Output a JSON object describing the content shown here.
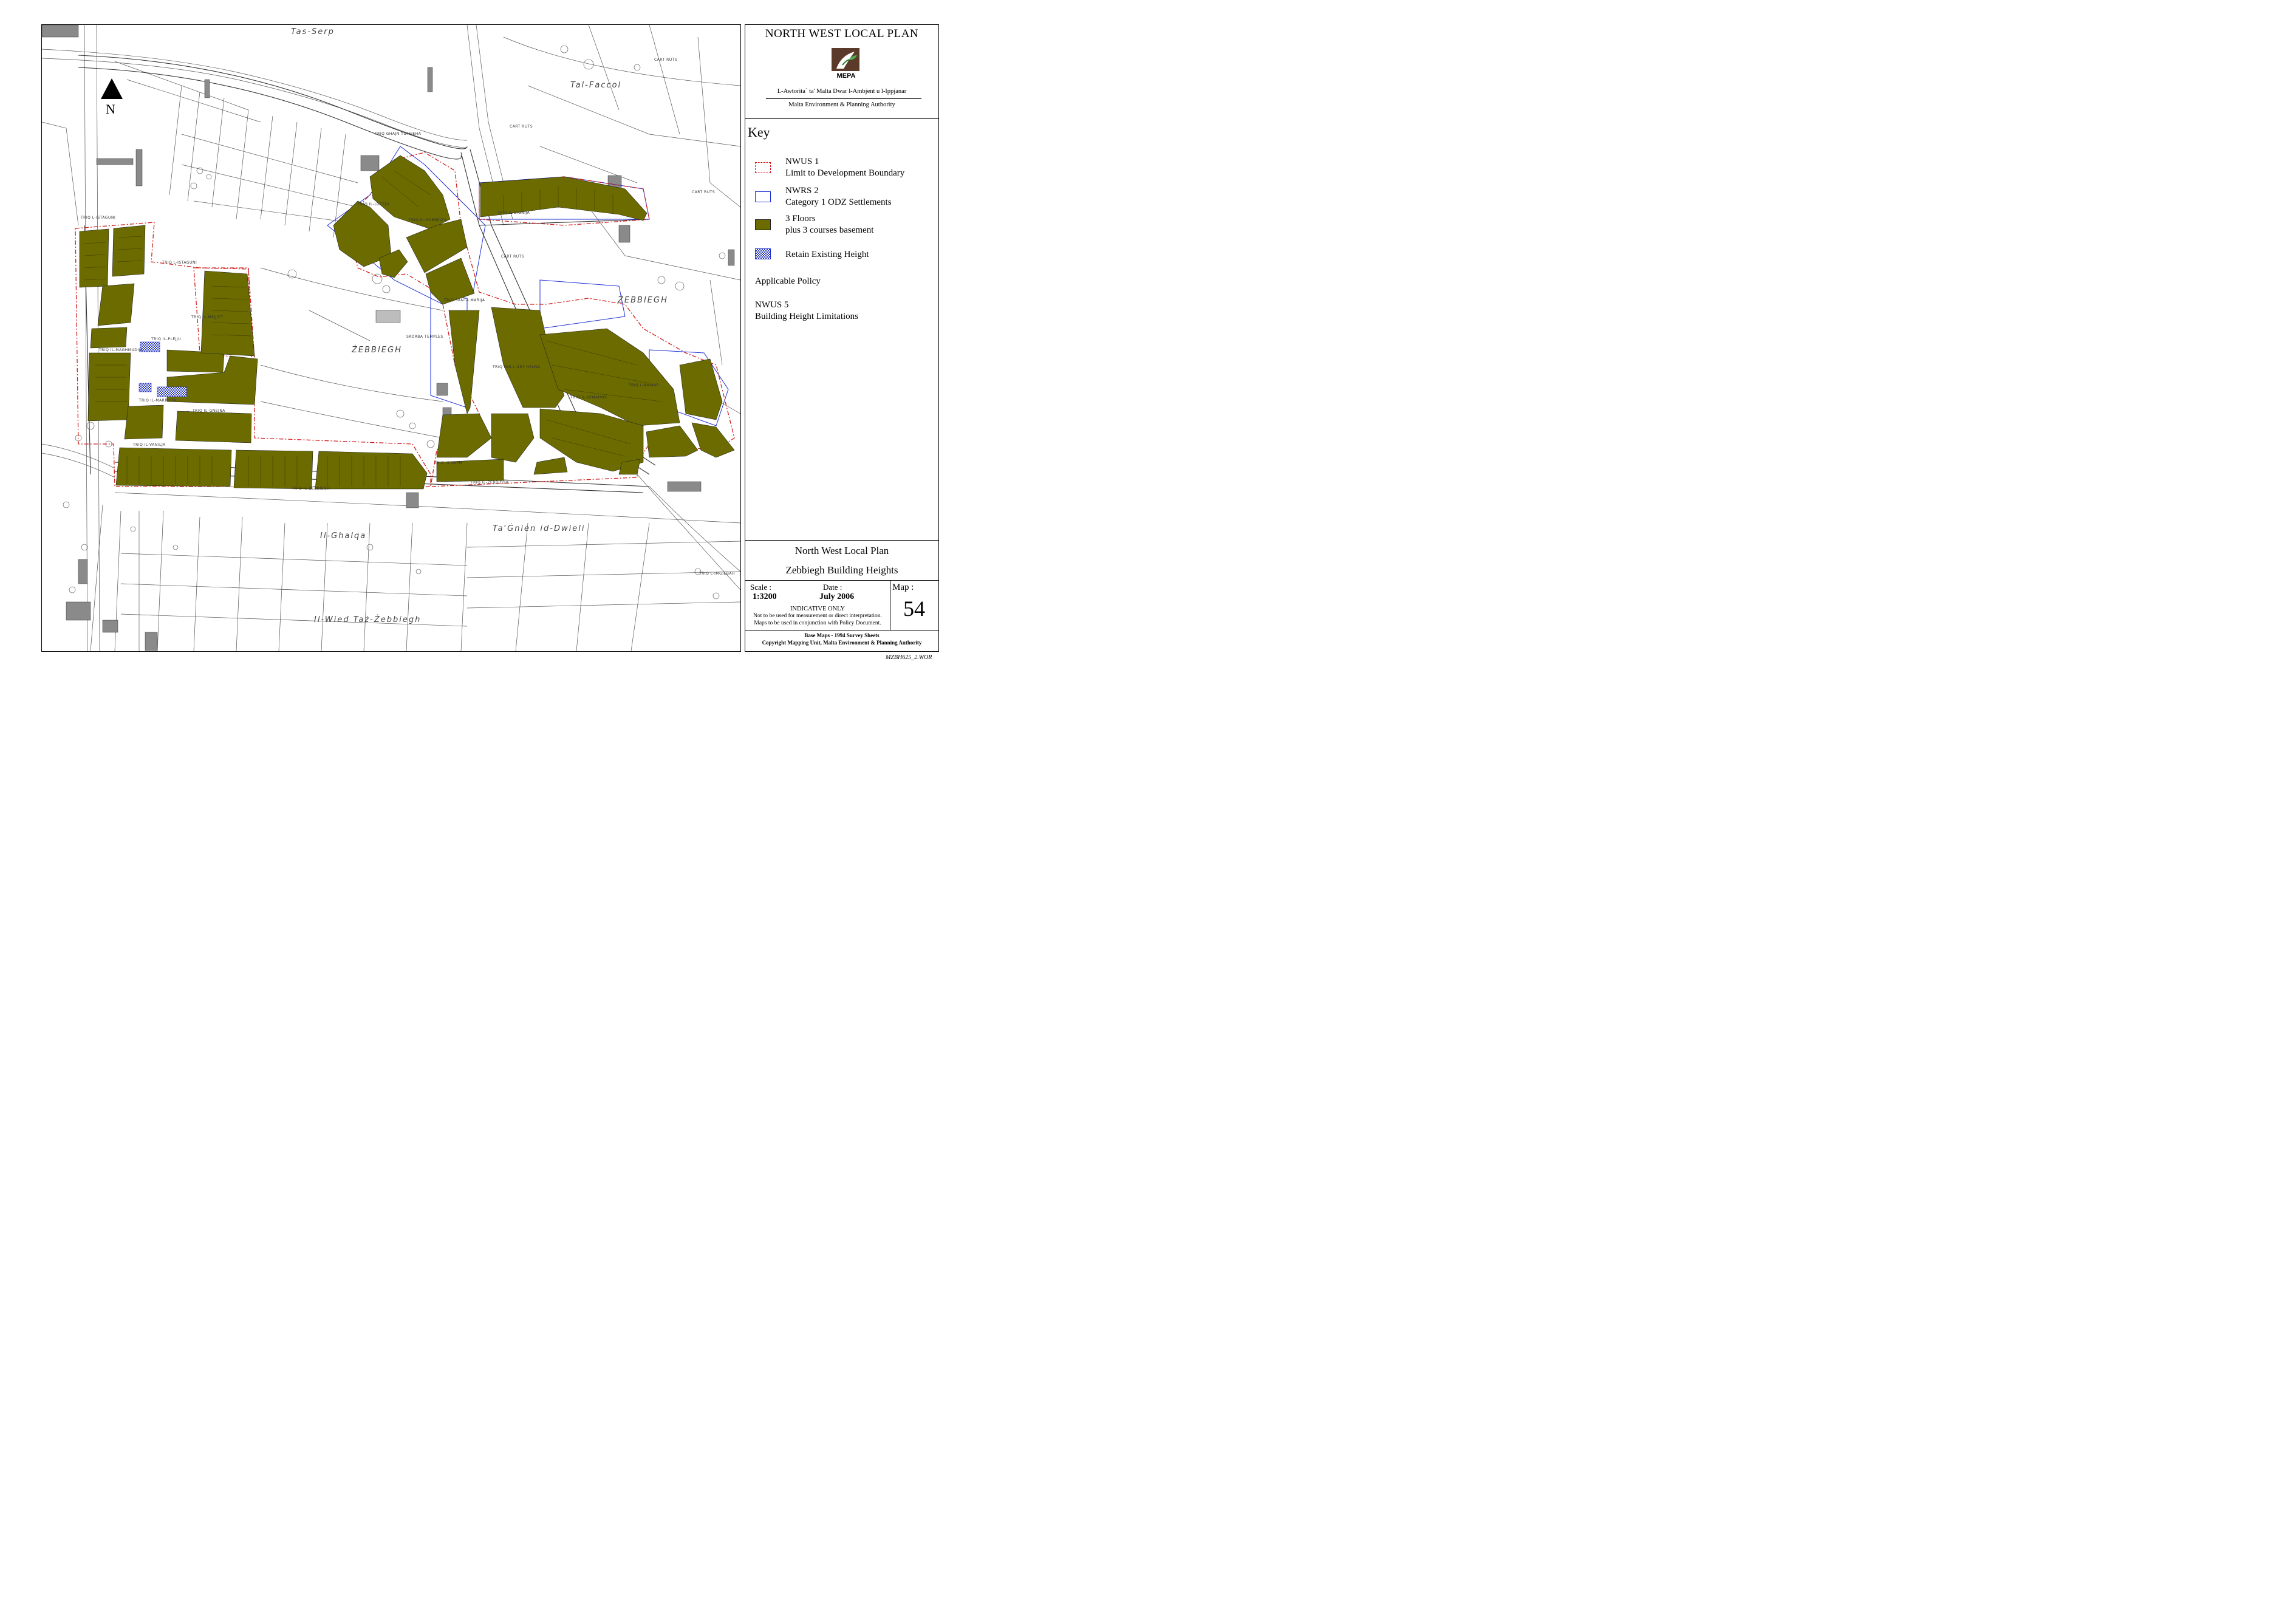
{
  "map": {
    "compass": "N",
    "place_names": [
      "Tas-Serp",
      "Tal-Faccol",
      "ŻEBBIEGH",
      "ŻEBBIEGH",
      "Il-Ghalqa",
      "Ta'Ġnien id-Dwieli",
      "Il-Wied Taż-Żebbiegh"
    ],
    "street_labels": [
      "TRIQ L-ISTAGUNI",
      "TRIQ L-ISTAGUNI",
      "TRIQ IL-PLEJJU",
      "TRIQ IL-MAGHMUDIJA",
      "TRIQ IL-MARRUBA",
      "TRIQ IL-VANILJA",
      "TRIQ IL-ŻEBBIEGH",
      "TRIQ IL-ŻEBBIEGH",
      "TRIQ IL-BIGNIJA",
      "TRIQ IL-HOBBEJZA",
      "TRIQ IL-LUZZJU",
      "TRIQ IS-SEPM",
      "TRIQ IL-GHAMMIX",
      "TRIQ L-AMMAR",
      "TRIQ GHAJN TUFFIEHA",
      "TRIQ DIN L-ART HELWA",
      "TRIQ L-IMGIEBAH",
      "SKORBA TEMPLES",
      "CART RUTS",
      "CART RUTS",
      "CART RUTS",
      "CART RUTS",
      "TRIQ IL-MEJJIET",
      "TRIQ SANTA MARIJA",
      "TRIQ IL-GNEJNA"
    ]
  },
  "panel": {
    "title": "NORTH WEST LOCAL PLAN",
    "logo_text": "MEPA",
    "authority_mt": "L-Awtorita` ta' Malta Dwar l-Ambjent u l-Ippjanar",
    "authority_en": "Malta Environment & Planning Authority",
    "key_heading": "Key",
    "key_items": [
      {
        "line1": "NWUS 1",
        "line2": "Limit to Development Boundary",
        "color": "#d21e1e"
      },
      {
        "line1": "NWRS 2",
        "line2": "Category 1 ODZ Settlements",
        "color": "#1f2fd6"
      },
      {
        "line1": "3 Floors",
        "line2": "plus 3 courses basement",
        "color": "#6b6b00"
      },
      {
        "line1": "Retain Existing Height",
        "line2": "",
        "color": "#2b3bb8"
      }
    ],
    "policy_label": "Applicable Policy",
    "policy_code": "NWUS 5",
    "policy_name": "Building Height Limitations",
    "map_plan": "North West Local Plan",
    "map_title": "Zebbiegh Building Heights",
    "scale_label": "Scale :",
    "scale_value": "1:3200",
    "date_label": "Date :",
    "date_value": "July 2006",
    "map_label": "Map :",
    "map_number": "54",
    "indicative": "INDICATIVE ONLY",
    "note1": "Not to be used for measurement or direct interpretation.",
    "note2": "Maps to be used in conjunction with Policy Document.",
    "base1": "Base Maps - 1994 Survey Sheets",
    "base2": "Copyright Mapping Unit, Malta Environment & Planning Authority"
  },
  "file_code": "MZBH625_2.WOR",
  "colors": {
    "olive": "#6b6b00",
    "boundary_red": "#d21e1e",
    "odz_blue": "#1f2fd6"
  }
}
